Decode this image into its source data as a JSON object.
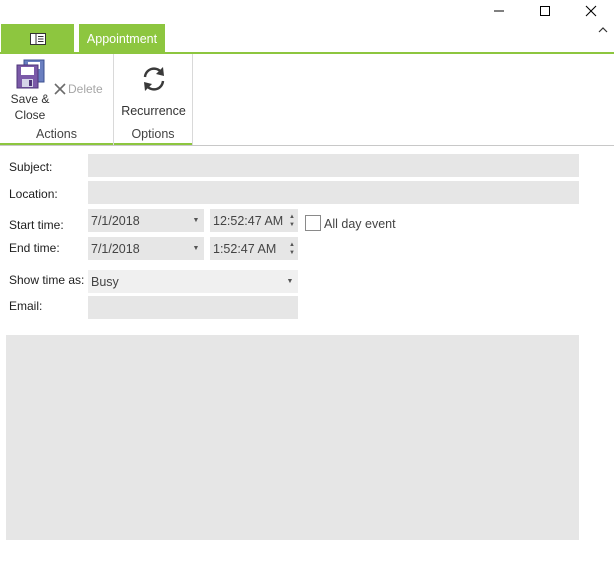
{
  "window": {
    "minimize_icon": "minimize-icon",
    "maximize_icon": "maximize-icon",
    "close_icon": "close-icon",
    "collapse_icon": "chevron-up-icon"
  },
  "ribbon": {
    "file_tab_icon": "backstage-menu-icon",
    "tabs": [
      {
        "label": "Appointment",
        "selected": true
      }
    ],
    "accent_color": "#8dc63f",
    "groups": {
      "actions": {
        "label": "Actions",
        "save_close_line1": "Save &",
        "save_close_line2": "Close",
        "delete_label": "Delete"
      },
      "options": {
        "label": "Options",
        "recurrence_label": "Recurrence"
      }
    }
  },
  "form": {
    "subject": {
      "label": "Subject:",
      "value": ""
    },
    "location": {
      "label": "Location:",
      "value": ""
    },
    "start": {
      "label": "Start time:",
      "date": "7/1/2018",
      "time": "12:52:47 AM"
    },
    "end": {
      "label": "End time:",
      "date": "7/1/2018",
      "time": "1:52:47 AM"
    },
    "all_day": {
      "label": "All day event",
      "checked": false
    },
    "show_time_as": {
      "label": "Show time as:",
      "value": "Busy"
    },
    "email": {
      "label": "Email:",
      "value": ""
    },
    "notes": ""
  }
}
